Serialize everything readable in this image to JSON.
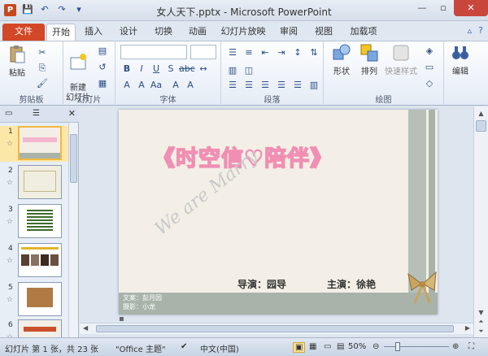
{
  "window": {
    "title": "女人天下.pptx - Microsoft PowerPoint",
    "app_letter": "P"
  },
  "tabs": {
    "file": "文件",
    "items": [
      "开始",
      "插入",
      "设计",
      "切换",
      "动画",
      "幻灯片放映",
      "审阅",
      "视图",
      "加载项"
    ]
  },
  "ribbon": {
    "paste_label": "粘贴",
    "new_slide_label": "新建\n幻灯片",
    "shape_label": "形状",
    "arrange_label": "排列",
    "quick_style_label": "快速样式",
    "edit_label": "编辑",
    "groups": {
      "clipboard": "剪贴板",
      "slides": "幻灯片",
      "font": "字体",
      "paragraph": "段落",
      "drawing": "绘图"
    }
  },
  "slides": {
    "numbers": [
      "1",
      "2",
      "3",
      "4",
      "5",
      "6"
    ]
  },
  "slide": {
    "title": "《时空信♡陪伴》",
    "handwriting": "We are Marry",
    "director": "导演：园导",
    "lead": "主演：徐艳",
    "credit_writer": "文案：彭月园",
    "credit_photo": "摄影：小龙"
  },
  "status": {
    "slide_info": "幻灯片 第 1 张，共 23 张",
    "theme": "\"Office 主题\"",
    "language": "中文(中国)",
    "zoom": "50%"
  },
  "colors": {
    "file_tab": "#d24726",
    "title_pink": "#f08fb3",
    "selected_thumb": "#f0b840"
  }
}
